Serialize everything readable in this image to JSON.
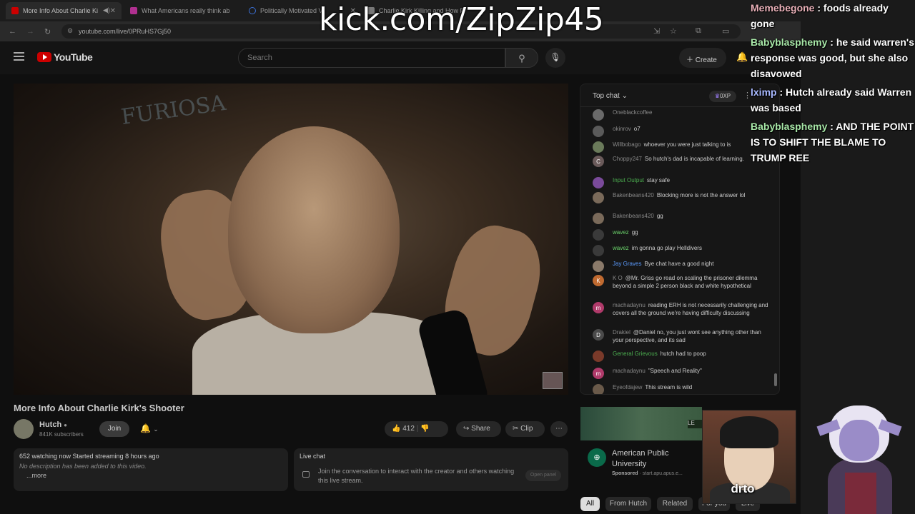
{
  "browser": {
    "tabs": [
      {
        "label": "More Info About Charlie Ki",
        "active": true,
        "favicon_color": "#cc0000"
      },
      {
        "label": "What Americans really think ab",
        "active": false,
        "favicon_color": "#b03090"
      },
      {
        "label": "Politically Motivated Vi",
        "active": false,
        "favicon_color": "#3b6fd4"
      },
      {
        "label": "Charlie Kirk Killing and How P",
        "active": false,
        "favicon_color": "#777777"
      }
    ],
    "url": "youtube.com/live/0PRuHS7Gj50"
  },
  "youtube": {
    "logo_text": "YouTube",
    "search_placeholder": "Search",
    "create_label": "Create"
  },
  "video": {
    "title": "More Info About Charlie Kirk's Shooter",
    "channel": "Hutch",
    "subscribers": "841K subscribers",
    "join_label": "Join",
    "likes": "412",
    "share_label": "Share",
    "clip_label": "Clip",
    "description": {
      "stats": "652 watching now  Started streaming 8 hours ago",
      "text": "No description has been added to this video.",
      "more": "...more"
    },
    "live_chat_box": {
      "title": "Live chat",
      "body": "Join the conversation to interact with the creator and others watching this live stream.",
      "open_panel": "Open panel"
    }
  },
  "chat": {
    "header": "Top chat",
    "xp_badge": "0XP",
    "messages": [
      {
        "user": "Oneblackcoffee",
        "text": "",
        "avatar": "",
        "avatar_color": "#6a6a6a"
      },
      {
        "user": "okinrov",
        "text": "o7",
        "avatar": "",
        "avatar_color": "#5a5a5a"
      },
      {
        "user": "Willbobago",
        "text": "whoever you were just talking to is",
        "avatar": "",
        "avatar_color": "#6a7a5a"
      },
      {
        "user": "Choppy247",
        "text": "So hutch's dad is incapable of learning.",
        "avatar": "C",
        "avatar_color": "#6a5a5a"
      },
      {
        "user": "Input Output",
        "text": "stay safe",
        "avatar": "",
        "avatar_color": "#7a4a9a"
      },
      {
        "user": "Bakenbeans420",
        "text": "Blocking more is not the answer lol",
        "avatar": "",
        "avatar_color": "#7a6a5a"
      },
      {
        "user": "Bakenbeans420",
        "text": "gg",
        "avatar": "",
        "avatar_color": "#7a6a5a"
      },
      {
        "user": "wavez",
        "text": "gg",
        "avatar": "",
        "avatar_color": "#3a3a3a"
      },
      {
        "user": "wavez",
        "text": "im gonna go play Helldivers",
        "avatar": "",
        "avatar_color": "#3a3a3a"
      },
      {
        "user": "Jay Graves",
        "text": "Bye chat have a good night",
        "avatar": "",
        "avatar_color": "#8a7a6a"
      },
      {
        "user": "K O",
        "text": "@Mr. Griss go read on scaling the prisoner dilemma beyond a simple 2 person black and white hypothetical",
        "avatar": "K",
        "avatar_color": "#c06a30"
      },
      {
        "user": "machadaynu",
        "text": "reading ERH is not necessarily challenging and covers all the ground we're having difficulty discussing",
        "avatar": "m",
        "avatar_color": "#b03a6a"
      },
      {
        "user": "Drakiel",
        "text": "@Daniel no, you just wont see anything other than your perspective, and its sad",
        "avatar": "D",
        "avatar_color": "#4a4a4a"
      },
      {
        "user": "General Grievous",
        "text": "hutch had to poop",
        "avatar": "",
        "avatar_color": "#7a3a2a"
      },
      {
        "user": "machadaynu",
        "text": "\"Speech and Reality\"",
        "avatar": "m",
        "avatar_color": "#b03a6a"
      },
      {
        "user": "Eyeofdajew",
        "text": "This stream is wild",
        "avatar": "",
        "avatar_color": "#6a5a4a"
      }
    ]
  },
  "ad": {
    "title": "American Public University",
    "sponsored": "Sponsored",
    "domain": "start.apu.apus.e..."
  },
  "chips": [
    "All",
    "From Hutch",
    "Related",
    "For you",
    "Live"
  ],
  "overlay": {
    "title": "kick.com/ZipZip45",
    "webcam_name": "drto",
    "chat": [
      {
        "user": "Memebegone",
        "text": "foods already gone",
        "color": "#e8b0b8"
      },
      {
        "user": "Babyblasphemy",
        "text": "he said warren's response was good, but she also disavowed",
        "color": "#a8e8a8"
      },
      {
        "user": "lximp",
        "text": "Hutch already said Warren was based",
        "color": "#a8b8ff"
      },
      {
        "user": "Babyblasphemy",
        "text": "AND THE POINT IS TO SHIFT THE BLAME TO TRUMP REE",
        "color": "#a8e8a8"
      }
    ]
  }
}
